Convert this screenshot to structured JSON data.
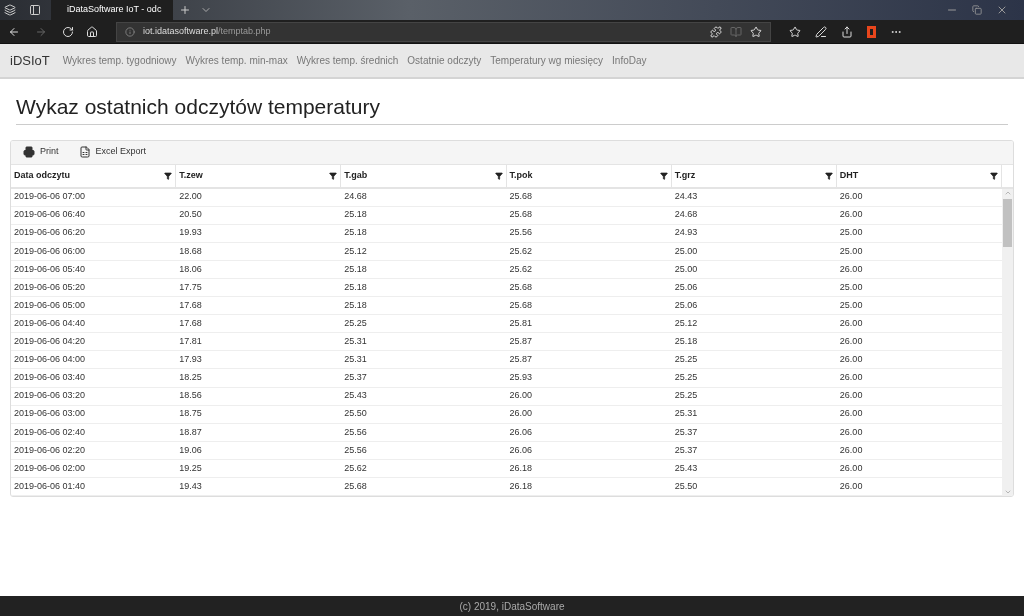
{
  "browser": {
    "tab_title": "iDataSoftware IoT - odc",
    "url_host": "iot.idatasoftware.pl",
    "url_path": "/temptab.php"
  },
  "navbar": {
    "brand": "iDSIoT",
    "items": [
      "Wykres temp. tygodniowy",
      "Wykres temp. min-max",
      "Wykres temp. średnich",
      "Ostatnie odczyty",
      "Temperatury wg miesięcy",
      "InfoDay"
    ]
  },
  "page_title": "Wykaz ostatnich odczytów temperatury",
  "toolbar": [
    {
      "kind": "print",
      "label": "Print"
    },
    {
      "kind": "excel",
      "label": "Excel Export"
    }
  ],
  "table": {
    "columns": [
      "Data odczytu",
      "T.zew",
      "T.gab",
      "T.pok",
      "T.grz",
      "DHT"
    ],
    "rows": [
      [
        "2019-06-06 07:00",
        "22.00",
        "24.68",
        "25.68",
        "24.43",
        "26.00"
      ],
      [
        "2019-06-06 06:40",
        "20.50",
        "25.18",
        "25.68",
        "24.68",
        "26.00"
      ],
      [
        "2019-06-06 06:20",
        "19.93",
        "25.18",
        "25.56",
        "24.93",
        "25.00"
      ],
      [
        "2019-06-06 06:00",
        "18.68",
        "25.12",
        "25.62",
        "25.00",
        "25.00"
      ],
      [
        "2019-06-06 05:40",
        "18.06",
        "25.18",
        "25.62",
        "25.00",
        "26.00"
      ],
      [
        "2019-06-06 05:20",
        "17.75",
        "25.18",
        "25.68",
        "25.06",
        "25.00"
      ],
      [
        "2019-06-06 05:00",
        "17.68",
        "25.18",
        "25.68",
        "25.06",
        "25.00"
      ],
      [
        "2019-06-06 04:40",
        "17.68",
        "25.25",
        "25.81",
        "25.12",
        "26.00"
      ],
      [
        "2019-06-06 04:20",
        "17.81",
        "25.31",
        "25.87",
        "25.18",
        "26.00"
      ],
      [
        "2019-06-06 04:00",
        "17.93",
        "25.31",
        "25.87",
        "25.25",
        "26.00"
      ],
      [
        "2019-06-06 03:40",
        "18.25",
        "25.37",
        "25.93",
        "25.25",
        "26.00"
      ],
      [
        "2019-06-06 03:20",
        "18.56",
        "25.43",
        "26.00",
        "25.25",
        "26.00"
      ],
      [
        "2019-06-06 03:00",
        "18.75",
        "25.50",
        "26.00",
        "25.31",
        "26.00"
      ],
      [
        "2019-06-06 02:40",
        "18.87",
        "25.56",
        "26.06",
        "25.37",
        "26.00"
      ],
      [
        "2019-06-06 02:20",
        "19.06",
        "25.56",
        "26.06",
        "25.37",
        "26.00"
      ],
      [
        "2019-06-06 02:00",
        "19.25",
        "25.62",
        "26.18",
        "25.43",
        "26.00"
      ],
      [
        "2019-06-06 01:40",
        "19.43",
        "25.68",
        "26.18",
        "25.50",
        "26.00"
      ]
    ]
  },
  "footer": "(c) 2019, iDataSoftware"
}
